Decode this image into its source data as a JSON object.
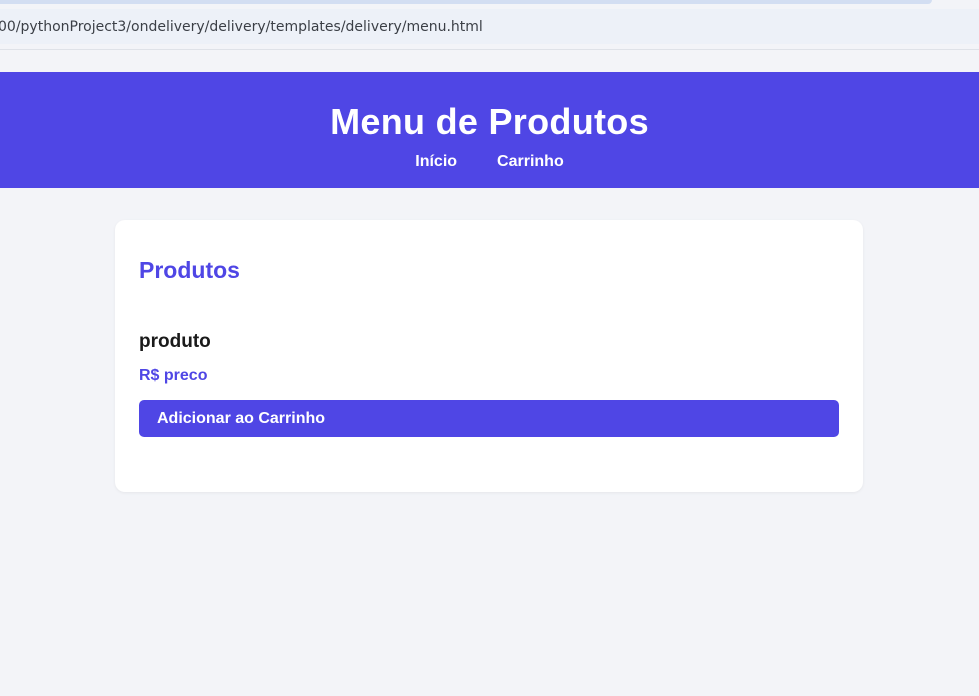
{
  "browser": {
    "address": "00/pythonProject3/ondelivery/delivery/templates/delivery/menu.html"
  },
  "header": {
    "title": "Menu de Produtos",
    "nav": [
      {
        "label": "Início"
      },
      {
        "label": "Carrinho"
      }
    ]
  },
  "main": {
    "section_title": "Produtos",
    "products": [
      {
        "name": "produto",
        "price": "R$ preco",
        "button_label": "Adicionar ao Carrinho"
      }
    ]
  },
  "colors": {
    "accent": "#4f46e5",
    "page_background": "#f3f4f8",
    "card_background": "#ffffff"
  }
}
